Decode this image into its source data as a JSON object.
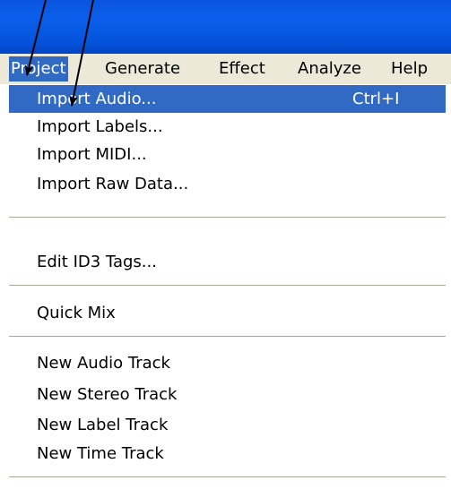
{
  "menubar": {
    "items": [
      {
        "label": "Project"
      },
      {
        "label": "Generate"
      },
      {
        "label": "Effect"
      },
      {
        "label": "Analyze"
      },
      {
        "label": "Help"
      }
    ]
  },
  "dropdown": {
    "items": [
      {
        "label": "Import Audio...",
        "shortcut": "Ctrl+I"
      },
      {
        "label": "Import Labels..."
      },
      {
        "label": "Import MIDI..."
      },
      {
        "label": "Import Raw Data..."
      },
      {
        "label": "Edit ID3 Tags..."
      },
      {
        "label": "Quick Mix"
      },
      {
        "label": "New Audio Track"
      },
      {
        "label": "New Stereo Track"
      },
      {
        "label": "New Label Track"
      },
      {
        "label": "New Time Track"
      }
    ]
  },
  "colors": {
    "titlebar": "#0a55e0",
    "menubar_bg": "#ece9d8",
    "highlight": "#316ac5",
    "annotation_arrow": "#000000"
  }
}
